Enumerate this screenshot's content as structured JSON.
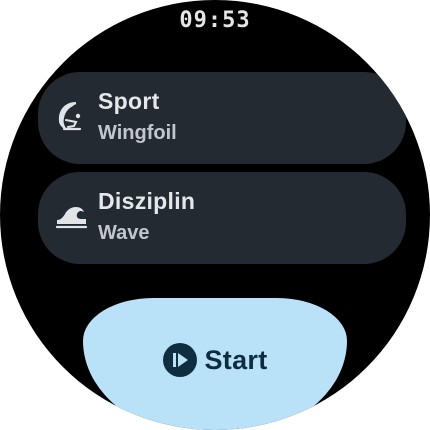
{
  "status": {
    "time": "09:53"
  },
  "items": [
    {
      "label": "Sport",
      "value": "Wingfoil",
      "icon": "wingfoil-icon"
    },
    {
      "label": "Disziplin",
      "value": "Wave",
      "icon": "wave-icon"
    }
  ],
  "start": {
    "label": "Start",
    "icon": "play-circle-icon"
  },
  "colors": {
    "background": "#000000",
    "chip": "#232a31",
    "start_button": "#b9e2f8",
    "start_text": "#0f2d40",
    "text": "#e6e7ea"
  }
}
